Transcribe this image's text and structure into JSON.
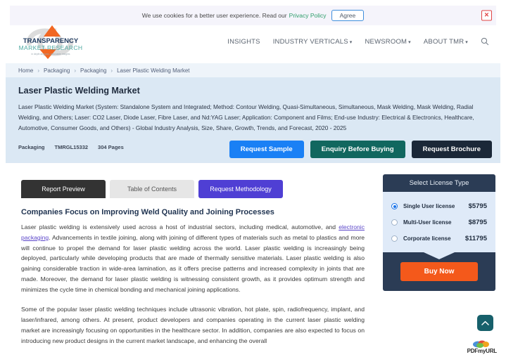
{
  "cookie": {
    "text_before": "We use cookies for a better user experience. Read our",
    "link": "Privacy Policy",
    "agree_label": "Agree",
    "close_icon": "close-icon",
    "close_glyph": "×"
  },
  "header": {
    "logo": {
      "line1": "TRANSPARENCY",
      "line2": "MARKET RESEARCH",
      "tagline": "in depth analysis, actionable insights",
      "colors": {
        "line1": "#1f3a5f",
        "line2": "#3f9e9a",
        "arrow": "#f26722",
        "ring": "#d9d9d9"
      }
    },
    "nav": [
      {
        "label": "INSIGHTS",
        "caret": false
      },
      {
        "label": "INDUSTRY VERTICALS",
        "caret": true
      },
      {
        "label": "NEWSROOM",
        "caret": true
      },
      {
        "label": "ABOUT TMR",
        "caret": true
      }
    ],
    "caret_glyph": "▾",
    "search_icon": "search-icon"
  },
  "breadcrumb": {
    "separator": "›",
    "items": [
      "Home",
      "Packaging",
      "Packaging",
      "Laser Plastic Welding Market"
    ]
  },
  "hero": {
    "title": "Laser Plastic Welding Market",
    "description": "Laser Plastic Welding Market (System: Standalone System and Integrated; Method: Contour Welding, Quasi-Simultaneous, Simultaneous, Mask Welding, Mask Welding, Radial Welding, and Others; Laser: CO2 Laser, Diode Laser, Fibre Laser, and Nd:YAG Laser; Application: Component and Films; End-use Industry: Electrical & Electronics, Healthcare, Automotive, Consumer Goods, and Others) - Global Industry Analysis, Size, Share, Growth, Trends, and Forecast, 2020 - 2025",
    "meta": {
      "category": "Packaging",
      "report_id": "TMRGL15332",
      "pages": "304 Pages"
    },
    "buttons": [
      {
        "label": "Request Sample",
        "color": "#1a80f5"
      },
      {
        "label": "Enquiry Before Buying",
        "color": "#11675f"
      },
      {
        "label": "Request Brochure",
        "color": "#1b2838"
      }
    ]
  },
  "tabs": [
    {
      "label": "Report Preview",
      "state": "active"
    },
    {
      "label": "Table of Contents",
      "state": "plain"
    },
    {
      "label": "Request Methodology",
      "state": "purple"
    }
  ],
  "article": {
    "heading": "Companies Focus on Improving Weld Quality and Joining Processes",
    "paragraph1_part1": "Laser plastic welding is extensively used across a host of industrial sectors, including medical, automotive, and ",
    "paragraph1_link": "electronic packaging",
    "paragraph1_part2": ". Advancements in textile joining, along with joining of different types of materials such as metal to plastics and more will continue to propel the demand for laser plastic welding across the world. Laser plastic welding is increasingly being deployed, particularly while developing products that are made of thermally sensitive materials. Laser plastic welding is also gaining considerable traction in wide-area lamination, as it offers precise patterns and increased complexity in joints that are made. Moreover, the demand for laser plastic welding is witnessing consistent growth, as it provides optimum strength and minimizes the cycle time in chemical bonding and mechanical joining applications.",
    "paragraph2": "Some of the popular laser plastic welding techniques include ultrasonic vibration, hot plate, spin, radiofrequency, implant, and laser/infrared, among others. At present, product developers and companies operating in the current laser plastic welding market are increasingly focusing on opportunities in the healthcare sector. In addition, companies are also expected to focus on introducing new product designs in the current market landscape, and enhancing the overall"
  },
  "license": {
    "title": "Select License Type",
    "options": [
      {
        "label": "Single User license",
        "price": "$5795",
        "selected": true
      },
      {
        "label": "Multi-User license",
        "price": "$8795",
        "selected": false
      },
      {
        "label": "Corporate license",
        "price": "$11795",
        "selected": false
      }
    ],
    "buy_label": "Buy Now",
    "buy_color": "#f4591b",
    "header_color": "#2b3c55"
  },
  "floating": {
    "to_top_icon": "chevron-up-icon",
    "to_top_color": "#17606b",
    "watermark": "PDFmyURL"
  }
}
